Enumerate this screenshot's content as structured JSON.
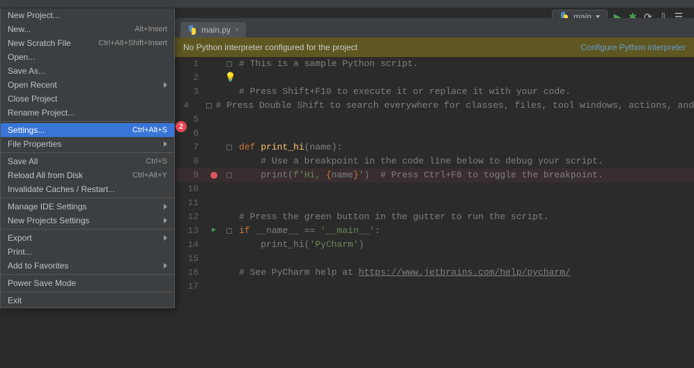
{
  "toolbar": {
    "run_config": "main",
    "icons": {
      "run": "▶",
      "debug": "✱",
      "rerun": "⟳",
      "update": "⇩",
      "search": "☰"
    }
  },
  "menu": [
    {
      "type": "item",
      "label": "New Project..."
    },
    {
      "type": "item",
      "label": "New...",
      "shortcut": "Alt+Insert"
    },
    {
      "type": "item",
      "label": "New Scratch File",
      "shortcut": "Ctrl+Alt+Shift+Insert"
    },
    {
      "type": "item",
      "label": "Open..."
    },
    {
      "type": "item",
      "label": "Save As..."
    },
    {
      "type": "item",
      "label": "Open Recent",
      "submenu": true
    },
    {
      "type": "item",
      "label": "Close Project"
    },
    {
      "type": "item",
      "label": "Rename Project..."
    },
    {
      "type": "sep"
    },
    {
      "type": "item",
      "label": "Settings...",
      "shortcut": "Ctrl+Alt+S",
      "selected": true
    },
    {
      "type": "item",
      "label": "File Properties",
      "submenu": true
    },
    {
      "type": "sep"
    },
    {
      "type": "item",
      "label": "Save All",
      "shortcut": "Ctrl+S"
    },
    {
      "type": "item",
      "label": "Reload All from Disk",
      "shortcut": "Ctrl+Alt+Y"
    },
    {
      "type": "item",
      "label": "Invalidate Caches / Restart..."
    },
    {
      "type": "sep"
    },
    {
      "type": "item",
      "label": "Manage IDE Settings",
      "submenu": true
    },
    {
      "type": "item",
      "label": "New Projects Settings",
      "submenu": true
    },
    {
      "type": "sep"
    },
    {
      "type": "item",
      "label": "Export",
      "submenu": true
    },
    {
      "type": "item",
      "label": "Print..."
    },
    {
      "type": "item",
      "label": "Add to Favorites",
      "submenu": true
    },
    {
      "type": "sep"
    },
    {
      "type": "item",
      "label": "Power Save Mode"
    },
    {
      "type": "sep"
    },
    {
      "type": "item",
      "label": "Exit"
    }
  ],
  "badge": "2",
  "tab": {
    "label": "main.py",
    "close": "×"
  },
  "notification": {
    "text": "No Python interpreter configured for the project",
    "link": "Configure Python interpreter"
  },
  "code": [
    {
      "n": 1,
      "fold": "-",
      "html": "<span class='cm'># This is a sample Python script.</span>"
    },
    {
      "n": 2,
      "bulb": true,
      "html": ""
    },
    {
      "n": 3,
      "html": "<span class='cm'># Press Shift+F10 to execute it or replace it with your code.</span>"
    },
    {
      "n": 4,
      "fold": "-",
      "html": "<span class='cm'># Press Double Shift to search everywhere for classes, files, tool windows, actions, and</span>"
    },
    {
      "n": 5,
      "html": ""
    },
    {
      "n": 6,
      "html": ""
    },
    {
      "n": 7,
      "fold": "-",
      "html": "<span class='kw'>def</span> <span class='fn'>print_hi</span>(name):"
    },
    {
      "n": 8,
      "html": "    <span class='cm'># Use a breakpoint in the code line below to debug your script.</span>"
    },
    {
      "n": 9,
      "breakpoint": true,
      "fold": "-",
      "cls": "line9",
      "html": "    print(<span class='str'>f'Hi, </span><span class='fstr'><span class='brace'>{</span>name<span class='brace'>}</span></span><span class='str'>'</span>)  <span class='cm'># Press Ctrl+F8 to toggle the breakpoint.</span>"
    },
    {
      "n": 10,
      "html": ""
    },
    {
      "n": 11,
      "html": ""
    },
    {
      "n": 12,
      "html": "<span class='cm'># Press the green button in the gutter to run the script.</span>"
    },
    {
      "n": 13,
      "run": true,
      "fold": "-",
      "html": "<span class='kw'>if</span> __name__ == <span class='str'>'__main__'</span>:"
    },
    {
      "n": 14,
      "html": "    print_hi(<span class='str'>'PyCharm'</span>)"
    },
    {
      "n": 15,
      "html": ""
    },
    {
      "n": 16,
      "html": "<span class='cm'># See PyCharm help at <span class='link'>https://www.jetbrains.com/help/pycharm/</span></span>"
    },
    {
      "n": 17,
      "html": ""
    }
  ]
}
